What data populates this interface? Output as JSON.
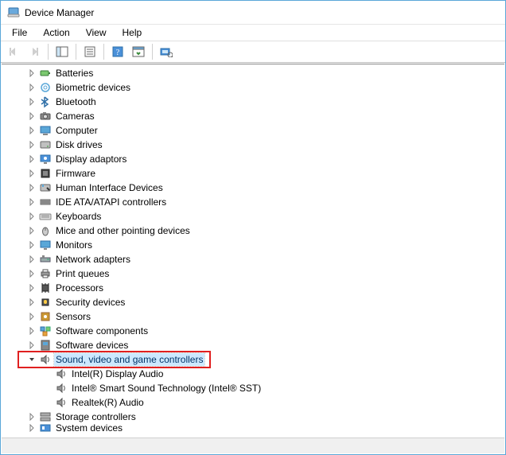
{
  "window": {
    "title": "Device Manager"
  },
  "menu": {
    "file": "File",
    "action": "Action",
    "view": "View",
    "help": "Help"
  },
  "tree": {
    "categories": [
      {
        "label": "Batteries",
        "icon": "battery"
      },
      {
        "label": "Biometric devices",
        "icon": "biometric"
      },
      {
        "label": "Bluetooth",
        "icon": "bluetooth"
      },
      {
        "label": "Cameras",
        "icon": "camera"
      },
      {
        "label": "Computer",
        "icon": "computer"
      },
      {
        "label": "Disk drives",
        "icon": "disk"
      },
      {
        "label": "Display adaptors",
        "icon": "display"
      },
      {
        "label": "Firmware",
        "icon": "firmware"
      },
      {
        "label": "Human Interface Devices",
        "icon": "hid"
      },
      {
        "label": "IDE ATA/ATAPI controllers",
        "icon": "ide"
      },
      {
        "label": "Keyboards",
        "icon": "keyboard"
      },
      {
        "label": "Mice and other pointing devices",
        "icon": "mouse"
      },
      {
        "label": "Monitors",
        "icon": "monitor"
      },
      {
        "label": "Network adapters",
        "icon": "network"
      },
      {
        "label": "Print queues",
        "icon": "printer"
      },
      {
        "label": "Processors",
        "icon": "cpu"
      },
      {
        "label": "Security devices",
        "icon": "security"
      },
      {
        "label": "Sensors",
        "icon": "sensor"
      },
      {
        "label": "Software components",
        "icon": "swcomp"
      },
      {
        "label": "Software devices",
        "icon": "swdev"
      }
    ],
    "expanded": {
      "label": "Sound, video and game controllers",
      "icon": "sound"
    },
    "children": [
      {
        "label": "Intel(R) Display Audio",
        "icon": "sound"
      },
      {
        "label": "Intel® Smart Sound Technology (Intel® SST)",
        "icon": "sound"
      },
      {
        "label": "Realtek(R) Audio",
        "icon": "sound"
      }
    ],
    "after": [
      {
        "label": "Storage controllers",
        "icon": "storage"
      },
      {
        "label": "System devices",
        "icon": "system",
        "cut": true
      }
    ]
  }
}
